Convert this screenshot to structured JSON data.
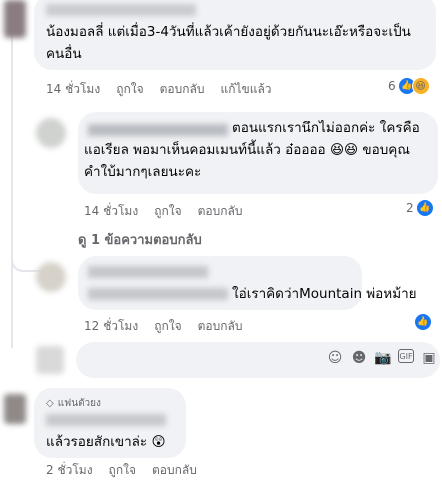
{
  "comments": [
    {
      "text_line1": "น้องมอลลี่ แต่เมื่อ3-4วันที่แล้วเค้ายังอยู่ด้วยกันนะเอ๊ะหรือจะเป็น",
      "text_line2": "คนอื่น",
      "time": "14 ชั่วโมง",
      "like": "ถูกใจ",
      "reply": "ตอบกลับ",
      "edit": "แก้ไขแล้ว",
      "reaction_count": "6"
    },
    {
      "text_line1": "ตอนแรกเรานึกไม่ออกค่ะ ใครคือ",
      "text_line2": "แอเรียล พอมาเห็นคอมเมนท์นี้แล้ว อ๋ออออ 😆😆 ขอบคุณ",
      "text_line3": "คำใบ้มากๆเลยนะคะ",
      "time": "14 ชั่วโมง",
      "like": "ถูกใจ",
      "reply": "ตอบกลับ",
      "reaction_count": "2",
      "view_replies": "ดู 1 ข้อความตอบกลับ"
    },
    {
      "text_line1": "ใอ่เราคิดว่าMountain พ่อหม้าย",
      "time": "12 ชั่วโมง",
      "like": "ถูกใจ",
      "reply": "ตอบกลับ"
    },
    {
      "badge": "แฟนตัวยง",
      "text_line1": "แล้วรอยสักเขาล่ะ 😲",
      "time": "2 ชั่วโมง",
      "like": "ถูกใจ",
      "reply": "ตอบกลับ"
    }
  ],
  "composer": {
    "icons": [
      "sticker-icon",
      "emoji-icon",
      "camera-icon",
      "gif-icon",
      "sticker-square-icon"
    ]
  }
}
